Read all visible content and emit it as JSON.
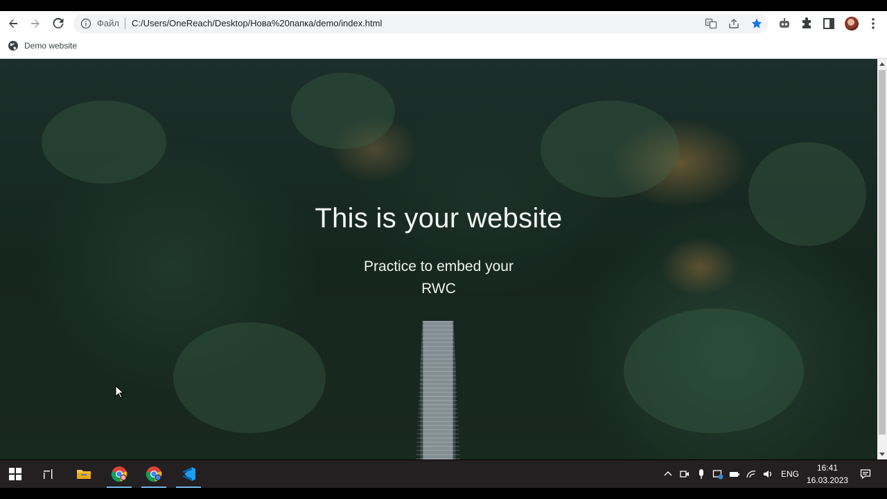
{
  "browser": {
    "omnibox": {
      "scheme_label": "Файл",
      "url": "C:/Users/OneReach/Desktop/Нова%20папка/demo/index.html"
    }
  },
  "bookmarks": {
    "items": [
      {
        "label": "Demo website",
        "icon": "globe-icon"
      }
    ]
  },
  "page": {
    "title": "This is your website",
    "subtitle": "Practice to embed your RWC"
  },
  "taskbar": {
    "apps": [
      "windows-start",
      "task-view",
      "file-explorer",
      "chrome",
      "chrome-profile",
      "vscode"
    ],
    "language": "ENG",
    "time": "16:41",
    "date": "16.03.2023"
  },
  "colors": {
    "accent_blue": "#1a73e8",
    "taskbar_bg": "#241f21",
    "taskbar_active": "#76b9ed"
  }
}
